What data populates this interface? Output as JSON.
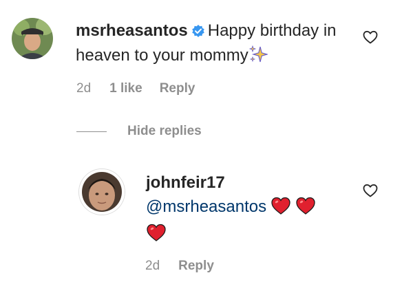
{
  "comment": {
    "username": "msrheasantos",
    "text": "Happy birthday in heaven to your mommy",
    "time": "2d",
    "likes": "1 like",
    "reply_label": "Reply"
  },
  "hide_replies_label": "Hide replies",
  "reply": {
    "username": "johnfeir17",
    "mention": "@msrheasantos",
    "time": "2d",
    "reply_label": "Reply"
  },
  "colors": {
    "text": "#262626",
    "secondary": "#8e8e8e",
    "mention": "#00376b",
    "verified": "#3897f0",
    "heart_emoji": "#e0202e"
  },
  "icons": [
    "verified-badge-icon",
    "sparkles-emoji-icon",
    "heart-outline-icon",
    "red-heart-emoji-icon"
  ]
}
